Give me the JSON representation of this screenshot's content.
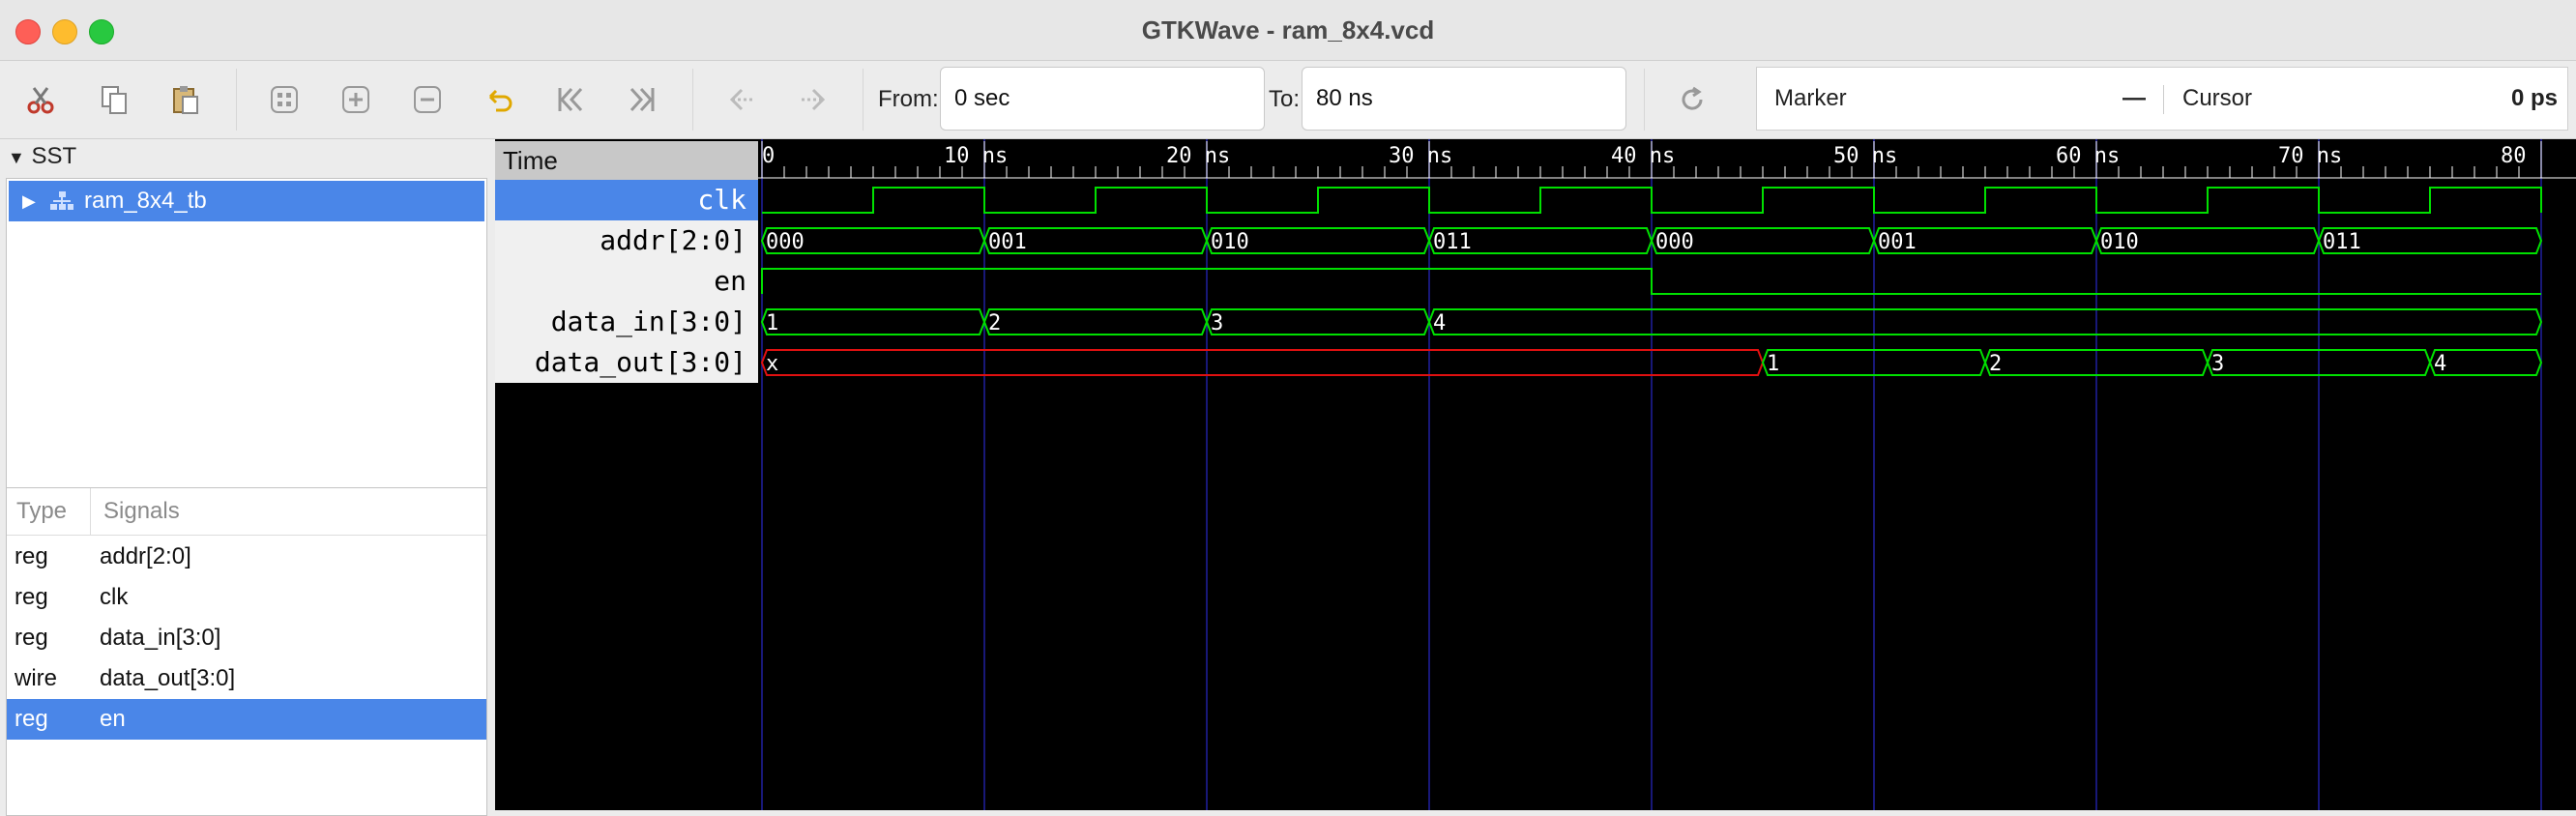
{
  "window": {
    "title": "GTKWave - ram_8x4.vcd"
  },
  "toolbar": {
    "icons": [
      "cut-icon",
      "copy-icon",
      "paste-icon",
      "zoom-fit-icon",
      "zoom-in-icon",
      "zoom-out-icon",
      "undo-icon",
      "first-icon",
      "last-icon",
      "prev-edge-icon",
      "next-edge-icon",
      "reload-icon"
    ],
    "from_label": "From:",
    "from_value": "0 sec",
    "to_label": "To:",
    "to_value": "80 ns",
    "marker_label": "Marker",
    "marker_value": "—",
    "cursor_label": "Cursor",
    "cursor_value": "0 ps"
  },
  "sst": {
    "header": "SST",
    "tree": [
      {
        "label": "ram_8x4_tb",
        "selected": true
      }
    ]
  },
  "signals": {
    "col_type": "Type",
    "col_signals": "Signals",
    "rows": [
      {
        "type": "reg",
        "name": "addr[2:0]",
        "selected": false
      },
      {
        "type": "reg",
        "name": "clk",
        "selected": false
      },
      {
        "type": "reg",
        "name": "data_in[3:0]",
        "selected": false
      },
      {
        "type": "wire",
        "name": "data_out[3:0]",
        "selected": false
      },
      {
        "type": "reg",
        "name": "en",
        "selected": true
      }
    ]
  },
  "wave_names": {
    "header": "Time",
    "rows": [
      "clk",
      "addr[2:0]",
      "en",
      "data_in[3:0]",
      "data_out[3:0]"
    ]
  },
  "wave": {
    "time_range_ns": [
      0,
      80
    ],
    "major_ticks": [
      {
        "t": 0,
        "label": "0"
      },
      {
        "t": 10,
        "label": "10 ns"
      },
      {
        "t": 20,
        "label": "20 ns"
      },
      {
        "t": 30,
        "label": "30 ns"
      },
      {
        "t": 40,
        "label": "40 ns"
      },
      {
        "t": 50,
        "label": "50 ns"
      },
      {
        "t": 60,
        "label": "60 ns"
      },
      {
        "t": 70,
        "label": "70 ns"
      },
      {
        "t": 80,
        "label": "80"
      }
    ],
    "clk_period_ns": 10,
    "clk_high_ns": [
      [
        5,
        10
      ],
      [
        15,
        20
      ],
      [
        25,
        30
      ],
      [
        35,
        40
      ],
      [
        45,
        50
      ],
      [
        55,
        60
      ],
      [
        65,
        70
      ],
      [
        75,
        80
      ]
    ],
    "addr": [
      {
        "from": 0,
        "to": 10,
        "value": "000"
      },
      {
        "from": 10,
        "to": 20,
        "value": "001"
      },
      {
        "from": 20,
        "to": 30,
        "value": "010"
      },
      {
        "from": 30,
        "to": 40,
        "value": "011"
      },
      {
        "from": 40,
        "to": 50,
        "value": "000"
      },
      {
        "from": 50,
        "to": 60,
        "value": "001"
      },
      {
        "from": 60,
        "to": 70,
        "value": "010"
      },
      {
        "from": 70,
        "to": 80,
        "value": "011"
      }
    ],
    "en_high_ns": [
      [
        0,
        40
      ]
    ],
    "data_in": [
      {
        "from": 0,
        "to": 10,
        "value": "1"
      },
      {
        "from": 10,
        "to": 20,
        "value": "2"
      },
      {
        "from": 20,
        "to": 30,
        "value": "3"
      },
      {
        "from": 30,
        "to": 80,
        "value": "4"
      }
    ],
    "data_out": [
      {
        "from": 0,
        "to": 45,
        "value": "x",
        "unknown": true
      },
      {
        "from": 45,
        "to": 55,
        "value": "1"
      },
      {
        "from": 55,
        "to": 65,
        "value": "2"
      },
      {
        "from": 65,
        "to": 75,
        "value": "3"
      },
      {
        "from": 75,
        "to": 80,
        "value": "4"
      }
    ],
    "colors": {
      "signal": "#00e000",
      "unknown": "#e01010",
      "grid": "#2020a0",
      "text": "#ffffff",
      "axis": "#ffffff"
    }
  }
}
